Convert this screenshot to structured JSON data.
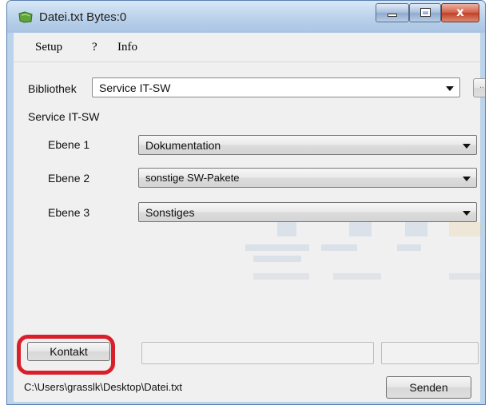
{
  "window": {
    "title": "Datei.txt Bytes:0",
    "close_glyph": "x"
  },
  "menu": {
    "items": [
      "Setup",
      "?",
      "Info"
    ]
  },
  "bibliothek": {
    "label": "Bibliothek",
    "value": "Service IT-SW",
    "browse_label": ".."
  },
  "group": {
    "title": "Service IT-SW",
    "levels": [
      {
        "label": "Ebene 1",
        "value": "Dokumentation"
      },
      {
        "label": "Ebene 2",
        "value": "sonstige SW-Pakete"
      },
      {
        "label": "Ebene 3",
        "value": "Sonstiges"
      }
    ]
  },
  "footer": {
    "kontakt_label": "Kontakt",
    "path": "C:\\Users\\grasslk\\Desktop\\Datei.txt",
    "senden_label": "Senden"
  },
  "colors": {
    "highlight": "#d91f2a",
    "titlebar": "#b9d1ea",
    "client": "#f0f0f0"
  }
}
